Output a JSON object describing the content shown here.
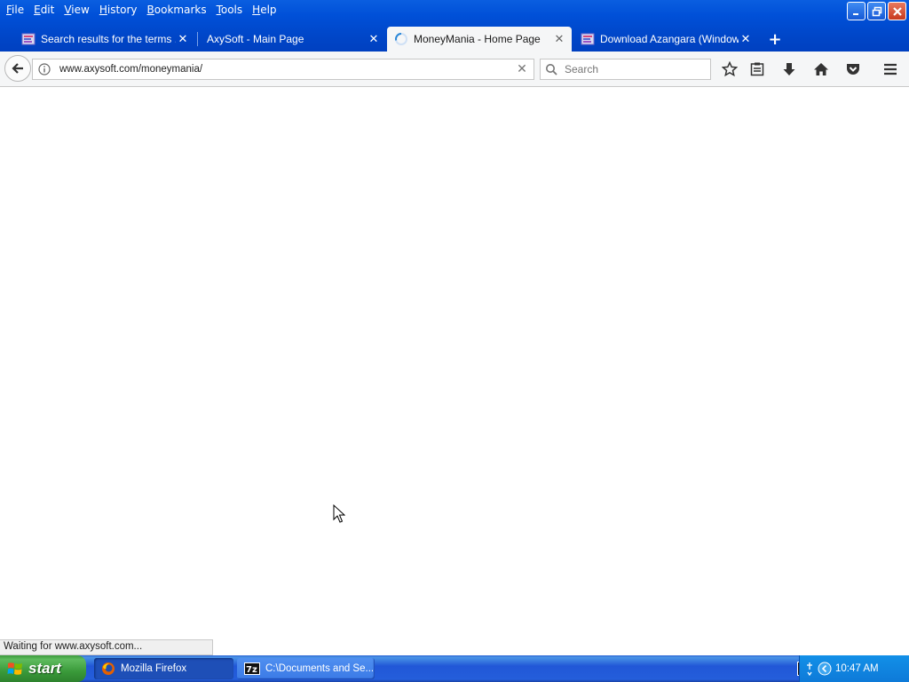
{
  "menu": [
    {
      "label": "File",
      "accel": "F",
      "rest": "ile"
    },
    {
      "label": "Edit",
      "accel": "E",
      "rest": "dit"
    },
    {
      "label": "View",
      "accel": "V",
      "rest": "iew"
    },
    {
      "label": "History",
      "accel": "H",
      "rest": "istory"
    },
    {
      "label": "Bookmarks",
      "accel": "B",
      "rest": "ookmarks"
    },
    {
      "label": "Tools",
      "accel": "T",
      "rest": "ools"
    },
    {
      "label": "Help",
      "accel": "H",
      "rest": "elp"
    }
  ],
  "tabs": [
    {
      "label": "Search results for the terms ...",
      "favicon": "site-icon",
      "active": false
    },
    {
      "label": "AxySoft - Main Page",
      "favicon": "none",
      "active": false
    },
    {
      "label": "MoneyMania - Home Page",
      "favicon": "loading-spinner-icon",
      "active": true
    },
    {
      "label": "Download Azangara (Window...",
      "favicon": "site-icon",
      "active": false
    }
  ],
  "newtab_label": "+",
  "navbar": {
    "url": "www.axysoft.com/moneymania/",
    "search_placeholder": "Search"
  },
  "status": "Waiting for www.axysoft.com...",
  "taskbar": {
    "start_label": "start",
    "tasks": [
      {
        "label": "Mozilla Firefox",
        "icon": "firefox-icon",
        "active": true
      },
      {
        "label": "C:\\Documents and Se...",
        "icon": "7zip-icon",
        "active": false
      }
    ],
    "clock": "10:47 AM"
  },
  "colors": {
    "titlebar": "#0050d8",
    "toolbar_bg": "#f5f6f7",
    "start_green": "#3a9a3a"
  }
}
